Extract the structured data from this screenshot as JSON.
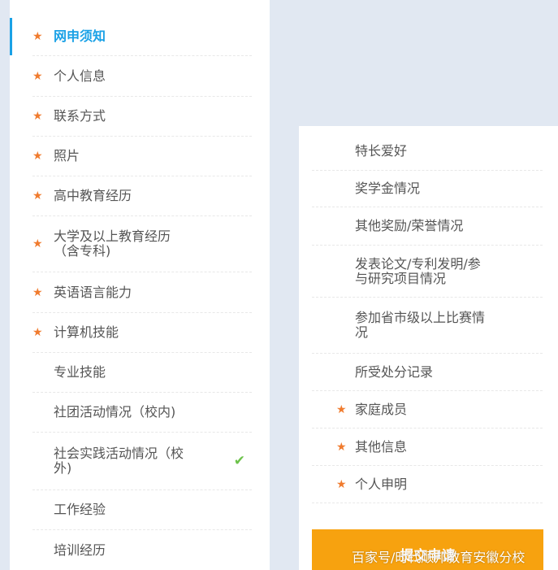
{
  "left_nav": {
    "items": [
      {
        "label": "网申须知",
        "required": true,
        "active": true
      },
      {
        "label": "个人信息",
        "required": true
      },
      {
        "label": "联系方式",
        "required": true
      },
      {
        "label": "照片",
        "required": true
      },
      {
        "label": "高中教育经历",
        "required": true
      },
      {
        "label": "大学及以上教育经历\n（含专科)",
        "required": true
      },
      {
        "label": "英语语言能力",
        "required": true
      },
      {
        "label": "计算机技能",
        "required": true
      },
      {
        "label": "专业技能",
        "required": false
      },
      {
        "label": "社团活动情况（校内)",
        "required": false
      },
      {
        "label": "社会实践活动情况（校\n外)",
        "required": false,
        "completed": true
      },
      {
        "label": "工作经验",
        "required": false
      },
      {
        "label": "培训经历",
        "required": false
      }
    ]
  },
  "right_nav": {
    "items": [
      {
        "label": "特长爱好",
        "required": false
      },
      {
        "label": "奖学金情况",
        "required": false
      },
      {
        "label": "其他奖励/荣誉情况",
        "required": false
      },
      {
        "label": "发表论文/专利发明/参\n与研究项目情况",
        "required": false
      },
      {
        "label": "参加省市级以上比赛情\n况",
        "required": false
      },
      {
        "label": "所受处分记录",
        "required": false
      },
      {
        "label": "家庭成员",
        "required": true
      },
      {
        "label": "其他信息",
        "required": true
      },
      {
        "label": "个人申明",
        "required": true
      }
    ]
  },
  "submit_label": "提交申请",
  "watermark": "百家号/时代顺邦教育安徽分校",
  "icons": {
    "required": "asterisk-icon",
    "completed": "checkmark-icon"
  },
  "colors": {
    "accent": "#1aa1e6",
    "required_star": "#f07b2e",
    "check": "#6cc24a",
    "submit": "#f7a20f",
    "page_bg": "#e1e8f2"
  }
}
